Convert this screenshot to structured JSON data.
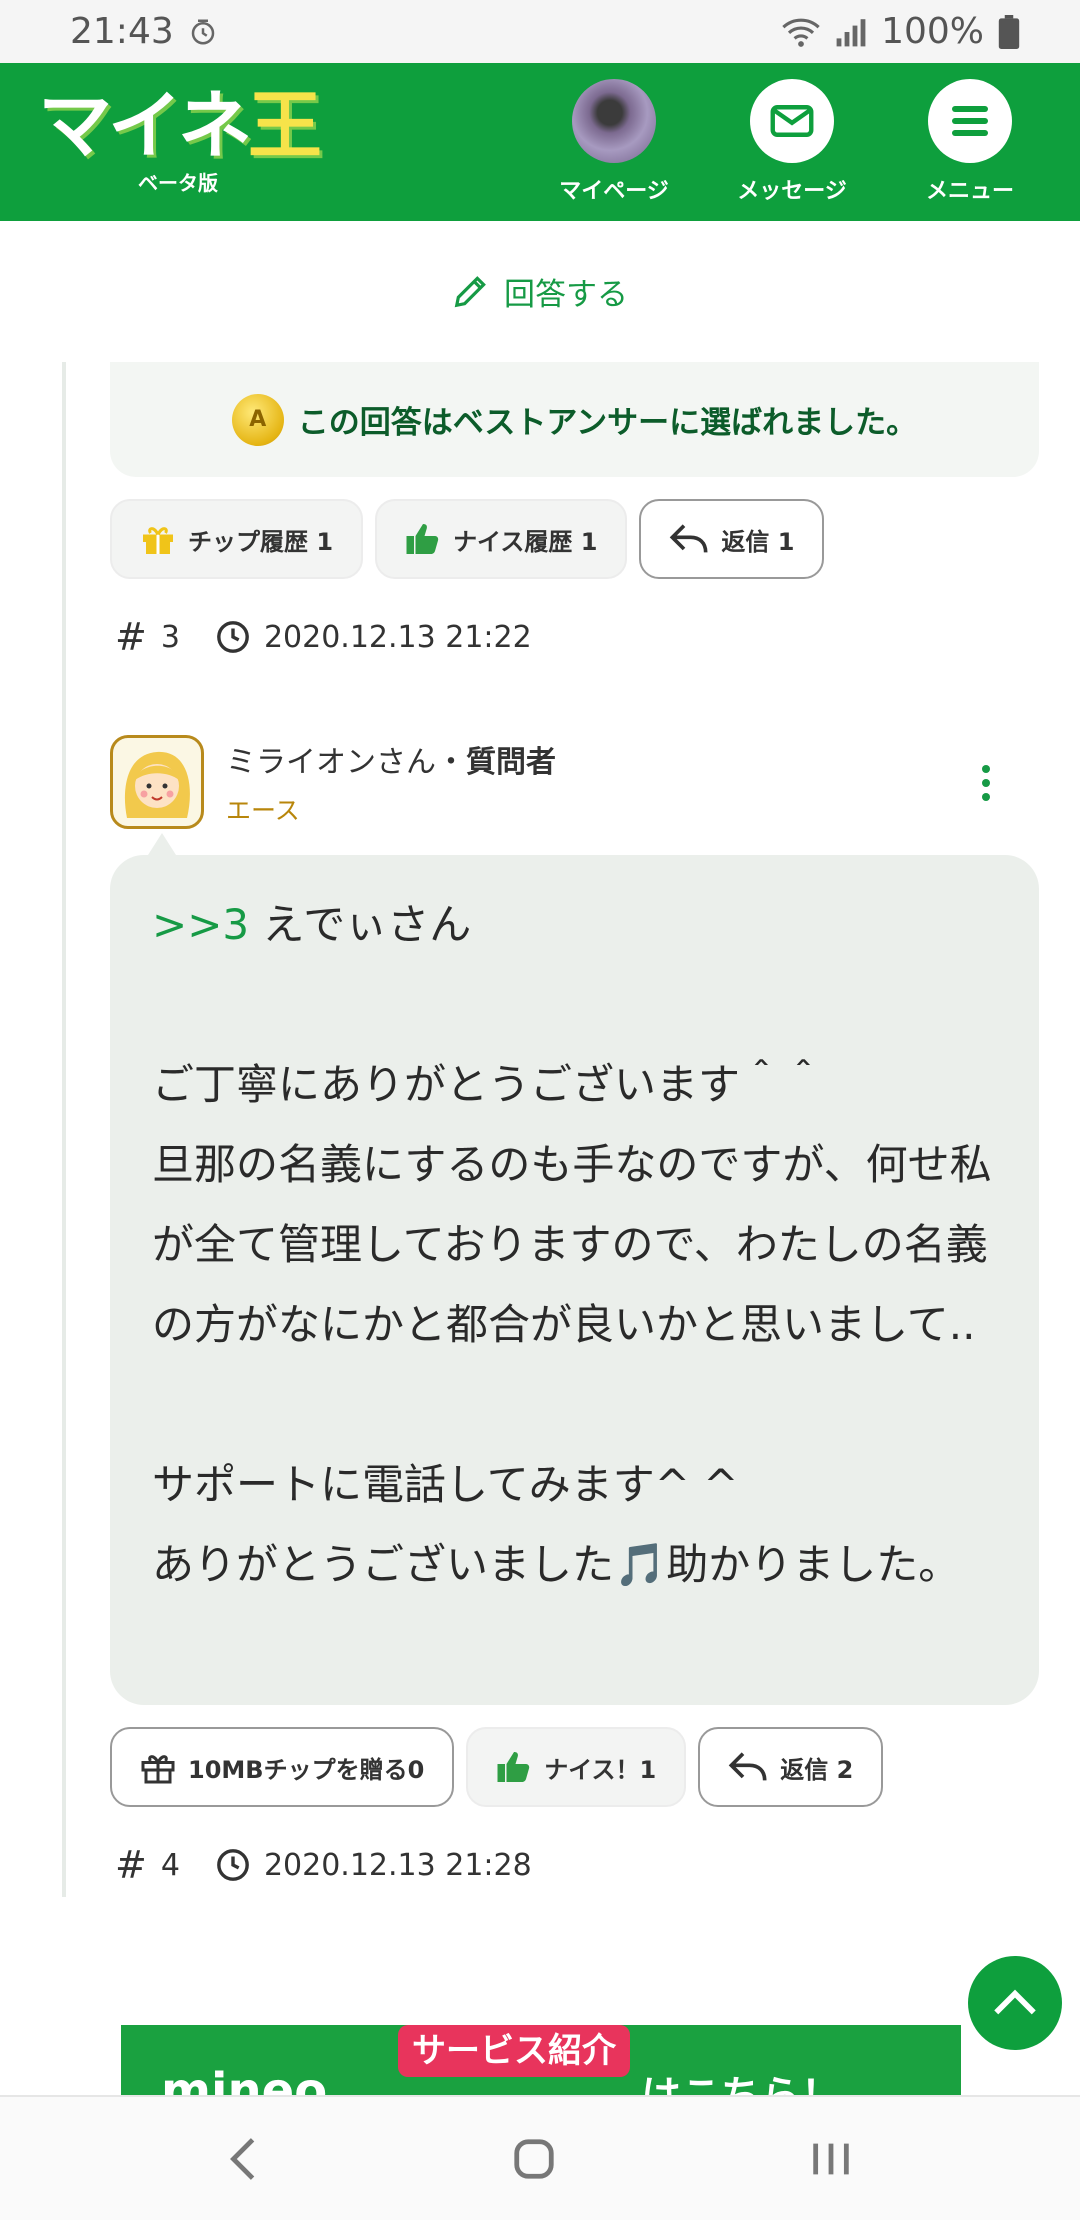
{
  "status_bar": {
    "time": "21:43",
    "battery": "100%"
  },
  "header": {
    "brand_main": "マイネ",
    "brand_accent": "王",
    "beta_label": "ベータ版",
    "nav": {
      "mypage": "マイページ",
      "message": "メッセージ",
      "menu": "メニュー"
    }
  },
  "answer_link": "回答する",
  "best_answer": {
    "medal_letter": "A",
    "text": "この回答はベストアンサーに選ばれました。"
  },
  "post3_buttons": {
    "tip_history": "チップ履歴 1",
    "nice_history": "ナイス履歴 1",
    "reply": "返信 1"
  },
  "post3_meta": {
    "hash": "#",
    "number": "3",
    "datetime": "2020.12.13 21:22"
  },
  "post4": {
    "user_name": "ミライオンさん・",
    "user_role": "質問者",
    "user_rank": "エース",
    "reply_ref": ">>3",
    "reply_to": " えでぃさん",
    "body": "\n\nご丁寧にありがとうございます＾＾\n旦那の名義にするのも手なのですが、何せ私が全て管理しておりますので、わたしの名義の方がなにかと都合が良いかと思いまして..\n\nサポートに電話してみます^ ^\nありがとうございました🎵助かりました。",
    "buttons": {
      "tip": "10MBチップを贈る0",
      "nice": "ナイス！1",
      "reply": "返信 2"
    },
    "meta": {
      "hash": "#",
      "number": "4",
      "datetime": "2020.12.13 21:28"
    }
  },
  "banner": {
    "tag": "サービス紹介",
    "brand": "mineo",
    "here": "はこちら！"
  },
  "colors": {
    "brand_green": "#0e9f3d",
    "link_green": "#169a45",
    "rank_gold": "#b8860b",
    "bubble_bg": "#ebefeb"
  }
}
